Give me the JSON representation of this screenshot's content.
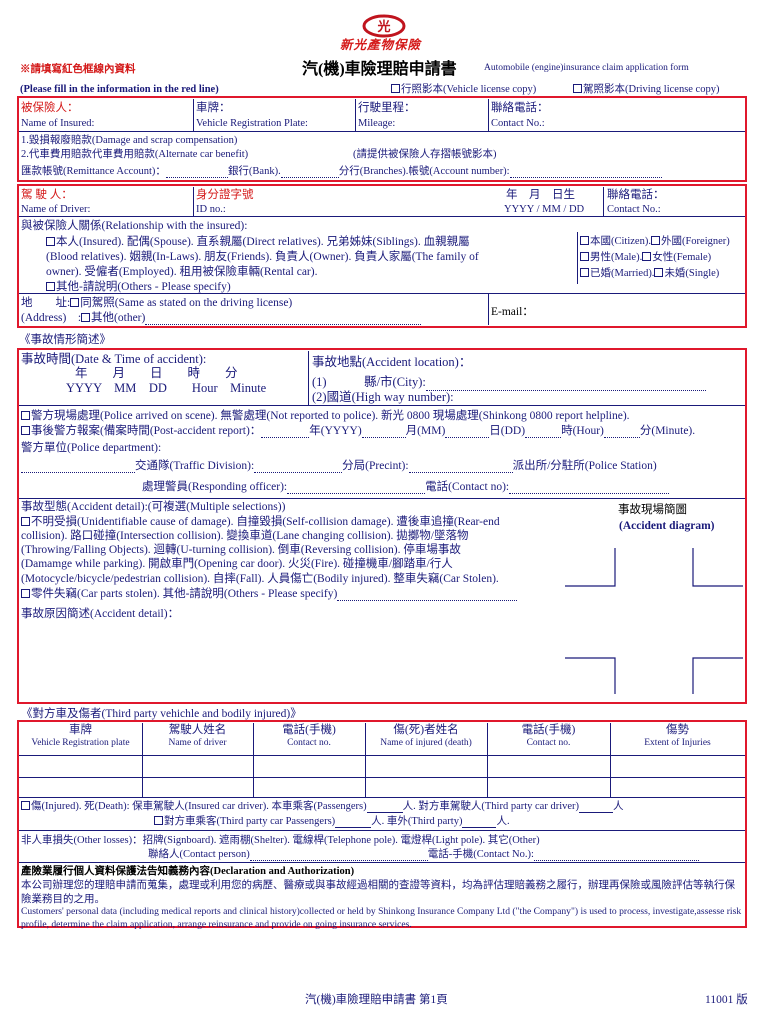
{
  "company": {
    "name": "新光產物保險"
  },
  "notice": {
    "zh": "※請填寫紅色框線內資料",
    "en": "(Please fill in the information in the red line)"
  },
  "title": {
    "zh": "汽(機)車險理賠申請書",
    "en": "Automobile (engine)insurance claim application form"
  },
  "attachments": {
    "license_copy": "行照影本(Vehicle license copy)",
    "driving_license_copy": "駕照影本(Driving license copy)"
  },
  "insured": {
    "name_zh": "被保險人：",
    "name_en": "Name of Insured:",
    "plate_zh": "車牌：",
    "plate_en": "Vehicle Registration Plate:",
    "mileage_zh": "行駛里程：",
    "mileage_en": "Mileage:",
    "contact_zh": "聯絡電話：",
    "contact_en": "Contact No.:",
    "line1": "1.毀損報廢賠款(Damage and scrap compensation)",
    "line2": "2.代車費用賠款代車費用賠款(Alternate car benefit)",
    "passbook": "(請提供被保險人存摺帳號影本)",
    "remit_zh": "匯款帳號(Remittance Account)：",
    "bank": "銀行(Bank).",
    "branch": "分行(Branches).帳號(Account number):"
  },
  "driver": {
    "name_zh": "駕 駛 人：",
    "name_en": "Name of Driver:",
    "id_zh": "身分證字號",
    "id_en": "ID no.:",
    "dob_zh": "年　月　日生",
    "dob_en": "YYYY / MM / DD",
    "contact_zh": "聯絡電話：",
    "contact_en": "Contact No.:",
    "relation_title": "與被保險人關係(Relationship with the insured):",
    "rel_line1": "本人(Insured). 配偶(Spouse). 直系親屬(Direct relatives). 兄弟姊妹(Siblings). 血親親屬",
    "rel_line2": "(Blood relatives). 姻親(In-Laws). 朋友(Friends). 負責人(Owner). 負責人家屬(The family of",
    "rel_line3": "owner). 受僱者(Employed). 租用被保險車輛(Rental car).",
    "rel_other": "其他-請說明(Others - Please specify)",
    "citizen": "本國(Citizen).",
    "foreigner": "外國(Foreigner)",
    "male": "男性(Male).",
    "female": "女性(Female)",
    "married": "已婚(Married).",
    "single": "未婚(Single)",
    "address_zh": "地　　址:",
    "address_same": "同駕照(Same as stated on the driving license)",
    "address_en": "(Address)　:",
    "address_other": "其他(other)",
    "email": "E-mail："
  },
  "accident": {
    "section": "《事故情形簡述》",
    "time_label": "事故時間(Date & Time of accident):",
    "time_zh": "年　　月　　日　　時　　分",
    "time_en": "YYYY　MM　DD　　Hour　Minute",
    "loc_label": "事故地點(Accident location)：",
    "loc1": "(1)　　　縣/市(City):",
    "loc2": "(2)國道(High way number):",
    "police1": "警方現場處理(Police arrived on scene). 無警處理(Not reported to police). 新光 0800 現場處理(Shinkong 0800 report helpline).",
    "police2a": "事後警方報案(備案時間(Post-accident report)：",
    "police2b": "年(YYYY)",
    "police2c": "月(MM)",
    "police2d": "日(DD)",
    "police2e": "時(Hour)",
    "police2f": "分(Minute).",
    "dept": "警方單位(Police department):",
    "traffic": "交通隊(Traffic Division):",
    "precinct": "分局(Precint):",
    "station": "派出所/分駐所(Police Station)",
    "officer": "處理警員(Responding officer):",
    "officer_contact": "電話(Contact no):",
    "type_title": "事故型態(Accident detail):(可複選(Multiple selections))",
    "type1": "不明受損(Unidentifiable cause of damage). 自撞毀損(Self-collision damage). 遭後車追撞(Rear-end",
    "type2": "collision). 路口碰撞(Intersection collision). 變換車道(Lane changing collision). 拋擲物/墜落物",
    "type3": "(Throwing/Falling Objects). 迴轉(U-turning collision). 倒車(Reversing collision). 停車場事故",
    "type4": "(Damamge while parking). 開啟車門(Opening car door). 火災(Fire). 碰撞機車/腳踏車/行人",
    "type5": "(Motocycle/bicycle/pedestrian collision). 自摔(Fall). 人員傷亡(Bodily injured). 整車失竊(Car Stolen).",
    "type6": "零件失竊(Car parts stolen). 其他-請說明(Others - Please specify)",
    "diagram_zh": "事故現場簡圖",
    "diagram_en": "(Accident diagram)",
    "cause": "事故原因簡述(Accident detail)："
  },
  "third": {
    "section": "《對方車及傷者(Third party vehichle and bodily injured)》",
    "headers": [
      {
        "zh": "車牌",
        "en": "Vehicle Registration plate"
      },
      {
        "zh": "駕駛人姓名",
        "en": "Name of driver"
      },
      {
        "zh": "電話(手機)",
        "en": "Contact no."
      },
      {
        "zh": "傷(死)者姓名",
        "en": "Name of injured (death)"
      },
      {
        "zh": "電話(手機)",
        "en": "Contact no."
      },
      {
        "zh": "傷勢",
        "en": "Extent of Injuries"
      }
    ],
    "inj1": "傷(Injured). 死(Death): 保車駕駛人(Insured car driver). 本車乘客(Passengers)",
    "inj1b": "人. 對方車駕駛人(Third party car driver)",
    "inj1c": "人",
    "inj2": "對方車乘客(Third party car Passengers)",
    "inj2b": "人. 車外(Third party)",
    "inj2c": "人.",
    "nonvehicle": "非人車損失(Other losses)：招牌(Signboard). 遮雨棚(Shelter). 電線桿(Telephone pole). 電燈桿(Light pole). 其它(Other)",
    "contact_person": "聯絡人(Contact person)",
    "contact_phone": "電話-手機(Contact No.):"
  },
  "declaration": {
    "title": "產險業履行個人資料保護法告知義務內容(Declaration and Authorization)",
    "zh": "本公司辦理您的理賠申請而蒐集，處理或利用您的病歷、醫療或與事故經過相關的查證等資料，均為評估理賠義務之履行，辦理再保險或風險評估等執行保險業務目的之用。",
    "en": "Customers' personal data (including medical reports and clinical history)collected or held by Shinkong Insurance Company Ltd (\"the Company\") is used to process, investigate,assesse risk profile, determine the claim application, arrange reinsurance and provide on going insurance services."
  },
  "footer": {
    "page": "汽(機)車險理賠申請書 第1頁",
    "version": "11001 版"
  }
}
